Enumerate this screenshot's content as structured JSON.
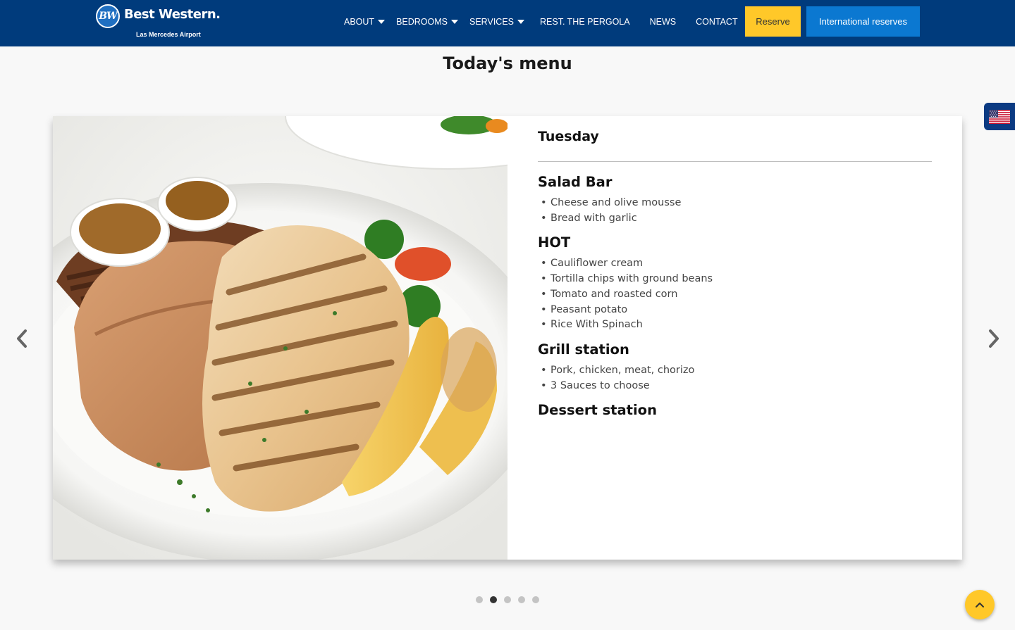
{
  "header": {
    "logo": {
      "initials": "BW",
      "name": "Best Western.",
      "location": "Las Mercedes Airport"
    },
    "nav": [
      {
        "label": "ABOUT",
        "has_dropdown": true
      },
      {
        "label": "BEDROOMS",
        "has_dropdown": true
      },
      {
        "label": "SERVICES",
        "has_dropdown": true
      },
      {
        "label": "REST. THE PERGOLA",
        "has_dropdown": false
      },
      {
        "label": "NEWS",
        "has_dropdown": false
      },
      {
        "label": "CONTACT",
        "has_dropdown": false
      }
    ],
    "reserve_label": "Reserve",
    "international_label": "International reserves"
  },
  "page": {
    "title": "Today's menu"
  },
  "language_flag": {
    "icon": "us-flag-icon"
  },
  "menu": {
    "day": "Tuesday",
    "sections": [
      {
        "title": "Salad Bar",
        "items": [
          "Cheese and olive mousse",
          "Bread with garlic"
        ]
      },
      {
        "title": "HOT",
        "items": [
          "Cauliflower cream",
          "Tortilla chips with ground beans",
          "Tomato and roasted corn",
          "Peasant potato",
          "Rice With Spinach"
        ]
      },
      {
        "title": "Grill station",
        "items": [
          "Pork, chicken, meat, chorizo",
          "3 Sauces to choose"
        ]
      },
      {
        "title": "Dessert station",
        "items": []
      }
    ]
  },
  "carousel": {
    "slide_count": 5,
    "active_index": 1
  },
  "colors": {
    "header_bg": "#003b7c",
    "reserve_bg": "#ffc829",
    "international_bg": "#0b78d1",
    "page_bg": "#f8f8f8"
  }
}
